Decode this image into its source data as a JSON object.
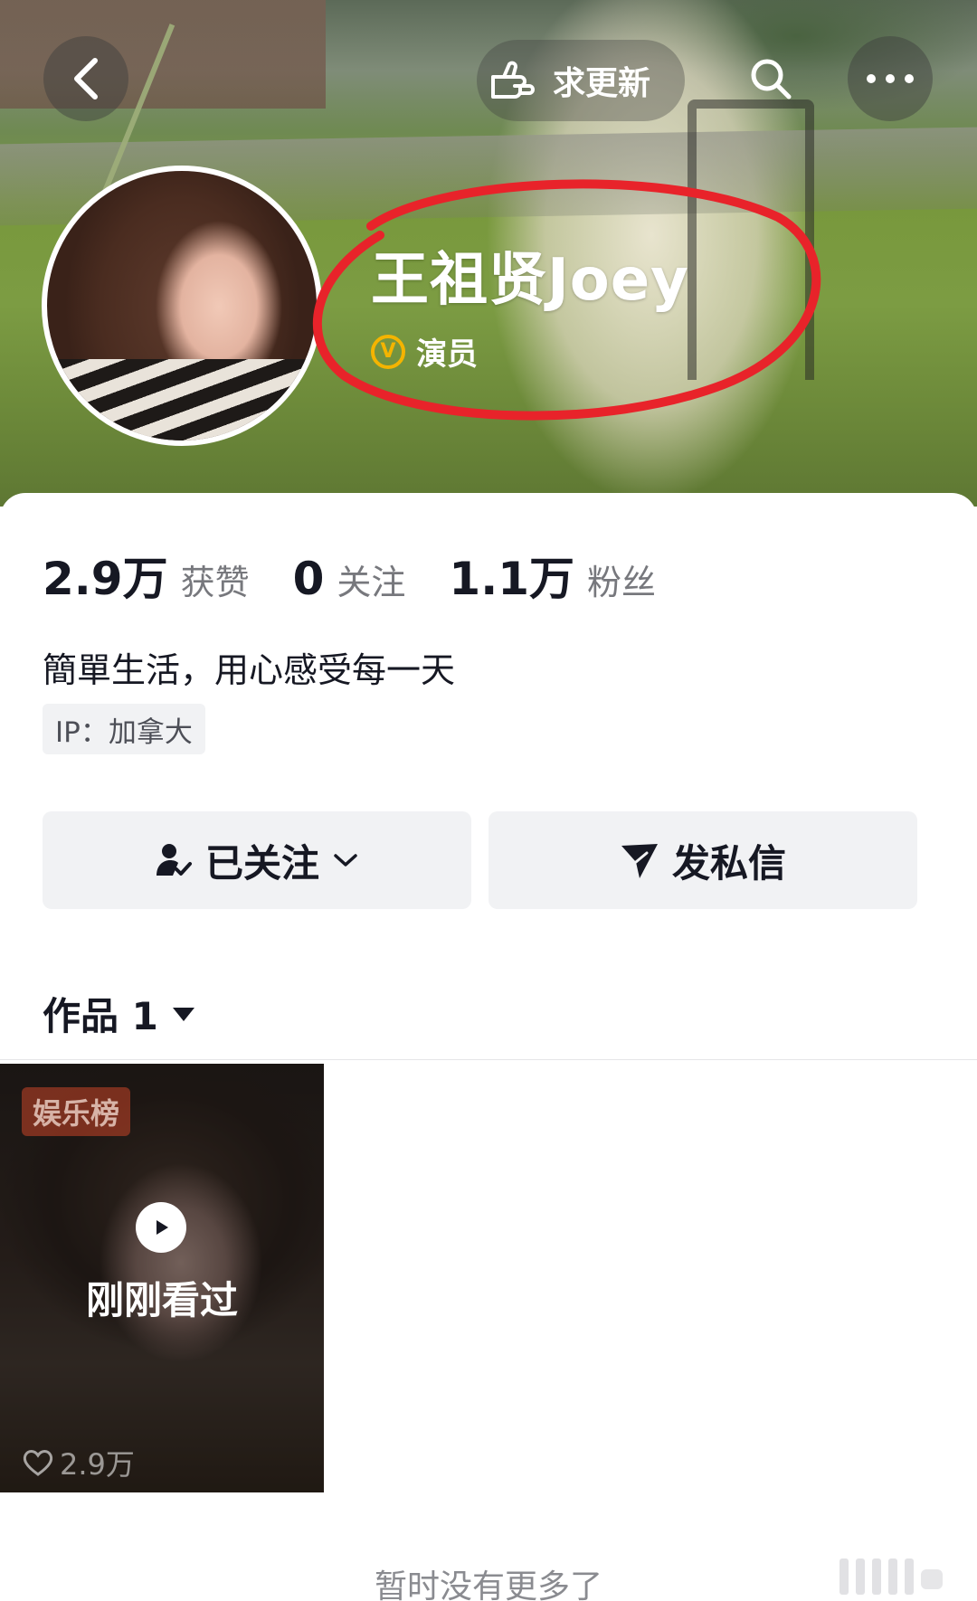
{
  "header": {
    "update_label": "求更新"
  },
  "profile": {
    "name": "王祖贤Joey",
    "verify_badge": "V",
    "verify_label": "演员"
  },
  "stats": [
    {
      "value": "2.9万",
      "label": "获赞"
    },
    {
      "value": "0",
      "label": "关注"
    },
    {
      "value": "1.1万",
      "label": "粉丝"
    }
  ],
  "bio": "簡單生活，用心感受每一天",
  "ip": "IP：加拿大",
  "actions": {
    "follow_label": "已关注",
    "message_label": "发私信"
  },
  "works": {
    "tab_label": "作品 1",
    "items": [
      {
        "badge": "娱乐榜",
        "status": "刚刚看过",
        "likes": "2.9万"
      }
    ]
  },
  "footer": "暂时没有更多了",
  "colors": {
    "verify": "#f4b400",
    "annotation": "#e8232a",
    "text_primary": "#161823",
    "text_secondary": "#77787d"
  }
}
